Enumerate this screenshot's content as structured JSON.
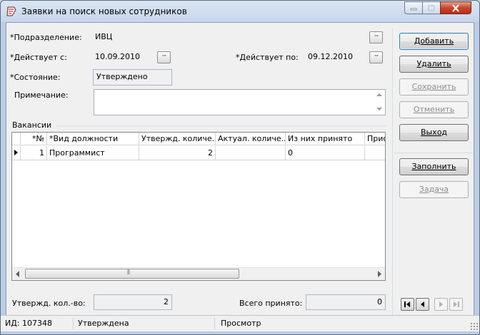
{
  "window": {
    "title": "Заявки на поиск новых сотрудников"
  },
  "form": {
    "division_label": "*Подразделение:",
    "division_value": "ИВЦ",
    "valid_from_label": "*Действует с:",
    "valid_from_value": "10.09.2010",
    "valid_to_label": "*Действует по:",
    "valid_to_value": "09.12.2010",
    "status_label": "*Состояние:",
    "status_value": "Утверждено",
    "note_label": "Примечание:",
    "note_value": "",
    "dots": "···"
  },
  "vacancies": {
    "group_label": "Вакансии",
    "columns": [
      "*№",
      "*Вид должности",
      "Утвержд. количе...",
      "Актуал. количе...",
      "Из них принято",
      "Приор"
    ],
    "rows": [
      {
        "num": "1",
        "position": "Программист",
        "approved": "2",
        "actual": "",
        "hired": "0",
        "priority": ""
      }
    ],
    "scroll_grip": "⦀"
  },
  "buttons": {
    "add": "Добавить",
    "delete": "Удалить",
    "save": "Сохранить",
    "cancel": "Отменить",
    "exit": "Выход",
    "fill": "Заполнить",
    "task": "Задача"
  },
  "totals": {
    "approved_label": "Утвержд. кол.-во:",
    "approved_value": "2",
    "hired_label": "Всего принято:",
    "hired_value": "0"
  },
  "status": {
    "id": "ИД: 107348",
    "state": "Утверждена",
    "mode": "Просмотр"
  },
  "colors": {
    "titlebar": "#c6d6ea",
    "close_button": "#c8452a"
  }
}
